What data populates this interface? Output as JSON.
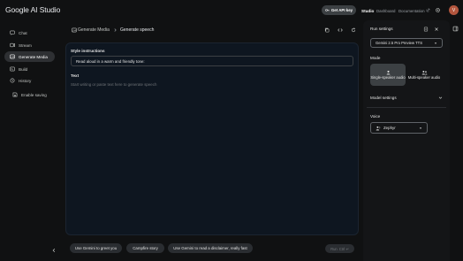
{
  "app": {
    "logo": "Google AI Studio",
    "avatar_initial": "V"
  },
  "topbar": {
    "api_key_label": "Get API key",
    "nav": [
      "Studio",
      "Dashboard",
      "Documentation"
    ]
  },
  "sidebar": {
    "items": [
      {
        "label": "Chat",
        "icon": "chat-icon"
      },
      {
        "label": "Stream",
        "icon": "stream-icon"
      },
      {
        "label": "Generate Media",
        "icon": "media-icon"
      },
      {
        "label": "Build",
        "icon": "build-icon"
      },
      {
        "label": "History",
        "icon": "history-icon"
      }
    ],
    "enable_saving": "Enable saving"
  },
  "header": {
    "breadcrumb_root": "Generate Media",
    "breadcrumb_current": "Generate speech"
  },
  "main": {
    "style_label": "Style instructions",
    "style_value": "Read aloud in a warm and friendly tone:",
    "text_label": "Text",
    "text_placeholder": "Start writing or paste text here to generate speech"
  },
  "chips": [
    "Use Gemini to greet you",
    "Campfire story",
    "Use Gemini to read a disclaimer, really fast"
  ],
  "run": {
    "label": "Run",
    "shortcut": "Ctrl ↵"
  },
  "run_settings": {
    "title": "Run settings",
    "model": "Gemini 2.5 Pro Preview TTS",
    "mode_label": "Mode",
    "modes": [
      "Single-speaker audio",
      "Multi-speaker audio"
    ],
    "selected_mode_index": 0,
    "model_settings_label": "Model settings",
    "voice_label": "Voice",
    "voice_value": "Zephyr"
  },
  "colors": {
    "background": "#101112",
    "panel": "#0e1620",
    "avatar": "#b3563e"
  }
}
